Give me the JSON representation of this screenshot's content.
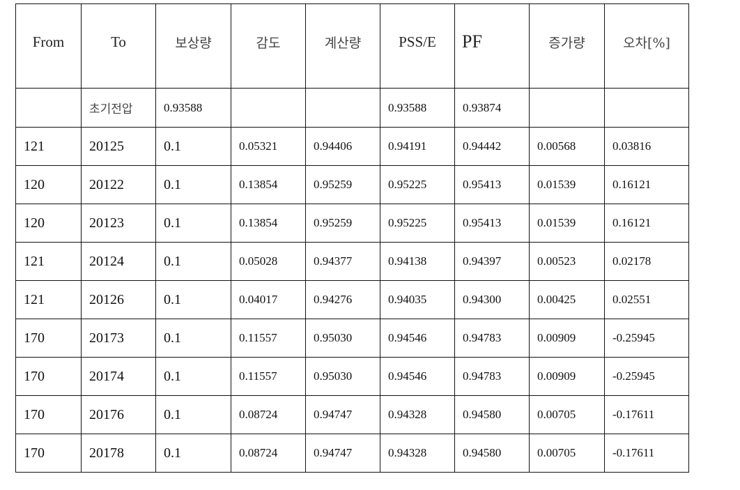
{
  "table": {
    "headers": [
      "From",
      "To",
      "보상량",
      "감도",
      "계산량",
      "PSS/E",
      "PF",
      "증가량",
      "오차[%]"
    ],
    "initial_row": [
      "",
      "초기전압",
      "0.93588",
      "",
      "",
      "0.93588",
      "0.93874",
      "",
      ""
    ],
    "rows": [
      [
        "121",
        "20125",
        "0.1",
        "0.05321",
        "0.94406",
        "0.94191",
        "0.94442",
        "0.00568",
        "0.03816"
      ],
      [
        "120",
        "20122",
        "0.1",
        "0.13854",
        "0.95259",
        "0.95225",
        "0.95413",
        "0.01539",
        "0.16121"
      ],
      [
        "120",
        "20123",
        "0.1",
        "0.13854",
        "0.95259",
        "0.95225",
        "0.95413",
        "0.01539",
        "0.16121"
      ],
      [
        "121",
        "20124",
        "0.1",
        "0.05028",
        "0.94377",
        "0.94138",
        "0.94397",
        "0.00523",
        "0.02178"
      ],
      [
        "121",
        "20126",
        "0.1",
        "0.04017",
        "0.94276",
        "0.94035",
        "0.94300",
        "0.00425",
        "0.02551"
      ],
      [
        "170",
        "20173",
        "0.1",
        "0.11557",
        "0.95030",
        "0.94546",
        "0.94783",
        "0.00909",
        "-0.25945"
      ],
      [
        "170",
        "20174",
        "0.1",
        "0.11557",
        "0.95030",
        "0.94546",
        "0.94783",
        "0.00909",
        "-0.25945"
      ],
      [
        "170",
        "20176",
        "0.1",
        "0.08724",
        "0.94747",
        "0.94328",
        "0.94580",
        "0.00705",
        "-0.17611"
      ],
      [
        "170",
        "20178",
        "0.1",
        "0.08724",
        "0.94747",
        "0.94328",
        "0.94580",
        "0.00705",
        "-0.17611"
      ]
    ]
  }
}
